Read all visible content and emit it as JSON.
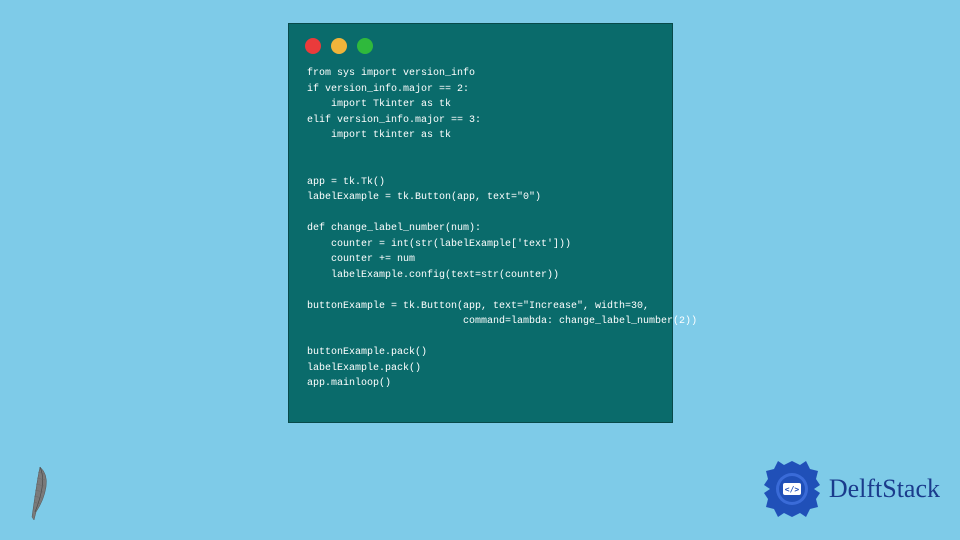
{
  "window": {
    "code_lines": [
      "from sys import version_info",
      "if version_info.major == 2:",
      "    import Tkinter as tk",
      "elif version_info.major == 3:",
      "    import tkinter as tk",
      "",
      "",
      "app = tk.Tk()",
      "labelExample = tk.Button(app, text=\"0\")",
      "",
      "def change_label_number(num):",
      "    counter = int(str(labelExample['text']))",
      "    counter += num",
      "    labelExample.config(text=str(counter))",
      "",
      "buttonExample = tk.Button(app, text=\"Increase\", width=30,",
      "                          command=lambda: change_label_number(2))",
      "",
      "buttonExample.pack()",
      "labelExample.pack()",
      "app.mainloop()"
    ]
  },
  "logo": {
    "text": "DelftStack"
  },
  "colors": {
    "background": "#7ecbe8",
    "window_bg": "#0a6b6b",
    "code_text": "#ffffff",
    "tl_red": "#ea3b3b",
    "tl_yellow": "#f0b43a",
    "tl_green": "#2fb93c",
    "logo_text": "#1a3b8c",
    "logo_badge": "#2050b8"
  }
}
